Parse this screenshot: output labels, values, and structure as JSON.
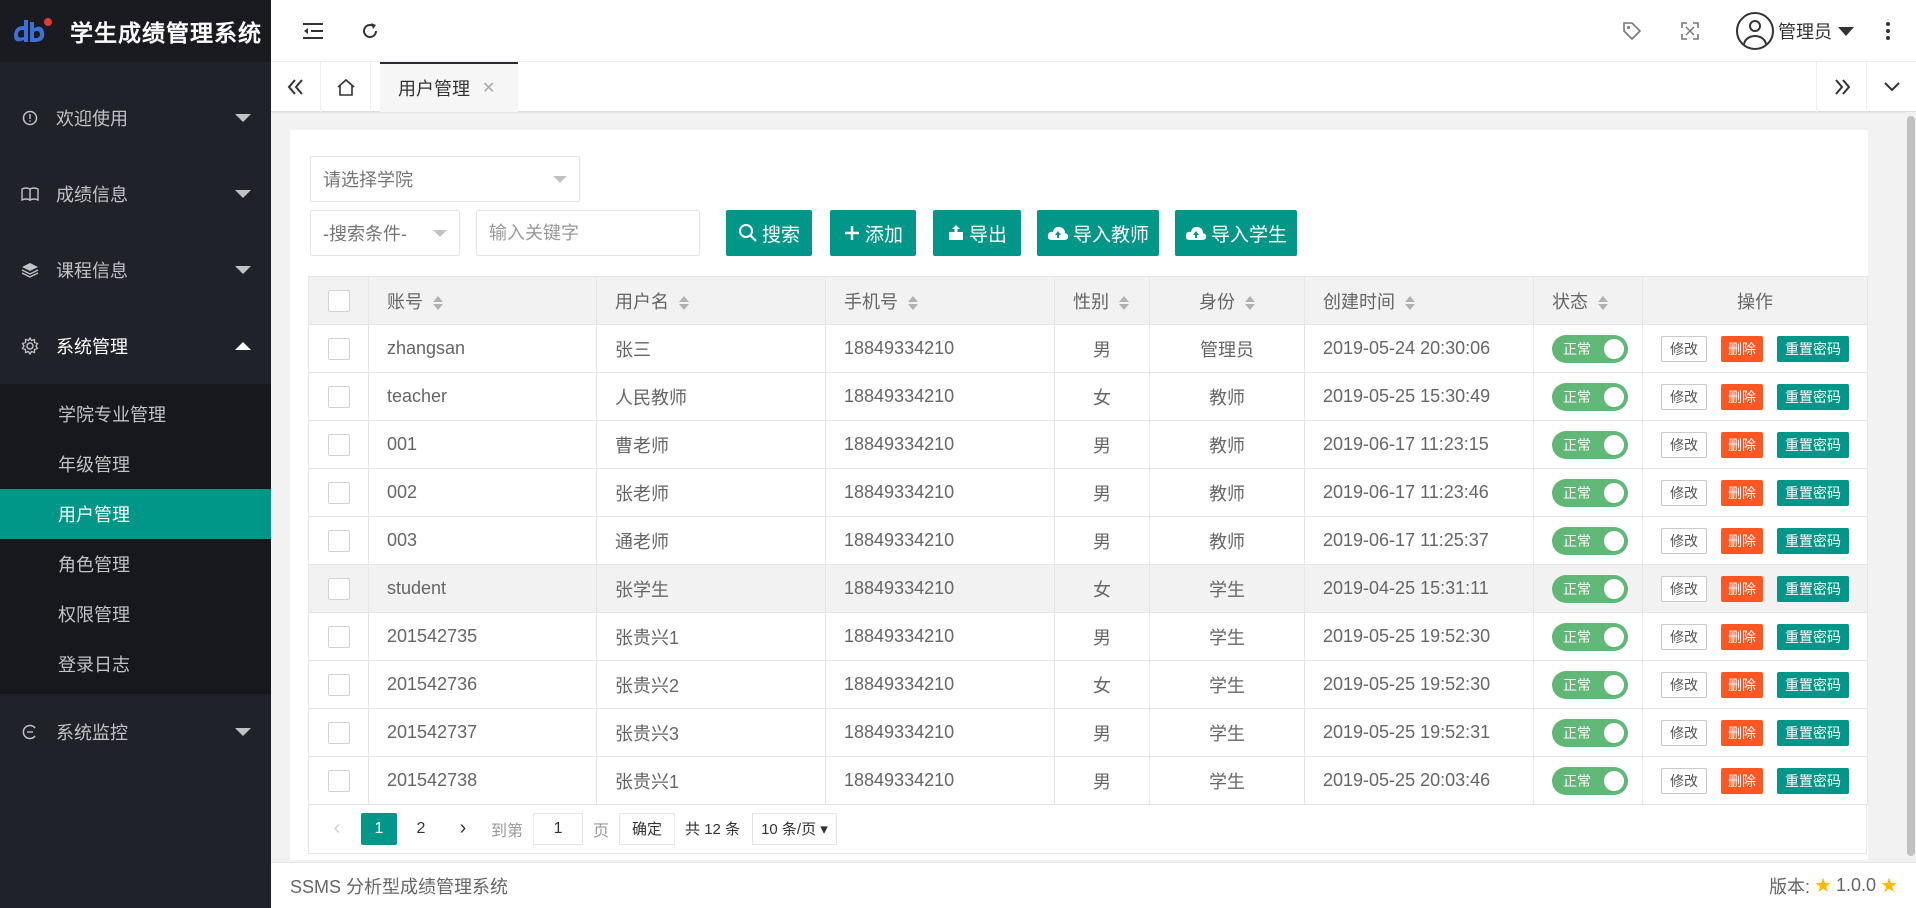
{
  "app": {
    "title": "学生成绩管理系统"
  },
  "sidebar": {
    "items": [
      {
        "label": "欢迎使用",
        "icon": "info-icon"
      },
      {
        "label": "成绩信息",
        "icon": "book-icon"
      },
      {
        "label": "课程信息",
        "icon": "layers-icon"
      },
      {
        "label": "系统管理",
        "icon": "gear-icon"
      },
      {
        "label": "系统监控",
        "icon": "monitor-icon"
      }
    ],
    "subitems": [
      "学院专业管理",
      "年级管理",
      "用户管理",
      "角色管理",
      "权限管理",
      "登录日志"
    ]
  },
  "header": {
    "user": "管理员"
  },
  "tabs": {
    "active": "用户管理"
  },
  "toolbar": {
    "college_placeholder": "请选择学院",
    "condition_placeholder": "-搜索条件-",
    "keyword_placeholder": "输入关键字",
    "search": "搜索",
    "add": "添加",
    "export": "导出",
    "import_teacher": "导入教师",
    "import_student": "导入学生"
  },
  "table": {
    "headers": [
      "账号",
      "用户名",
      "手机号",
      "性别",
      "身份",
      "创建时间",
      "状态",
      "操作"
    ],
    "status_label": "正常",
    "edit_label": "修改",
    "delete_label": "删除",
    "reset_label": "重置密码",
    "rows": [
      {
        "account": "zhangsan",
        "name": "张三",
        "phone": "18849334210",
        "gender": "男",
        "role": "管理员",
        "created": "2019-05-24 20:30:06"
      },
      {
        "account": "teacher",
        "name": "人民教师",
        "phone": "18849334210",
        "gender": "女",
        "role": "教师",
        "created": "2019-05-25 15:30:49"
      },
      {
        "account": "001",
        "name": "曹老师",
        "phone": "18849334210",
        "gender": "男",
        "role": "教师",
        "created": "2019-06-17 11:23:15"
      },
      {
        "account": "002",
        "name": "张老师",
        "phone": "18849334210",
        "gender": "男",
        "role": "教师",
        "created": "2019-06-17 11:23:46"
      },
      {
        "account": "003",
        "name": "通老师",
        "phone": "18849334210",
        "gender": "男",
        "role": "教师",
        "created": "2019-06-17 11:25:37"
      },
      {
        "account": "student",
        "name": "张学生",
        "phone": "18849334210",
        "gender": "女",
        "role": "学生",
        "created": "2019-04-25 15:31:11"
      },
      {
        "account": "201542735",
        "name": "张贵兴1",
        "phone": "18849334210",
        "gender": "男",
        "role": "学生",
        "created": "2019-05-25 19:52:30"
      },
      {
        "account": "201542736",
        "name": "张贵兴2",
        "phone": "18849334210",
        "gender": "女",
        "role": "学生",
        "created": "2019-05-25 19:52:30"
      },
      {
        "account": "201542737",
        "name": "张贵兴3",
        "phone": "18849334210",
        "gender": "男",
        "role": "学生",
        "created": "2019-05-25 19:52:31"
      },
      {
        "account": "201542738",
        "name": "张贵兴1",
        "phone": "18849334210",
        "gender": "男",
        "role": "学生",
        "created": "2019-05-25 20:03:46"
      }
    ]
  },
  "pager": {
    "pages": [
      "1",
      "2"
    ],
    "goto_label": "到第",
    "goto_value": "1",
    "page_unit": "页",
    "confirm": "确定",
    "total": "共 12 条",
    "size": "10 条/页"
  },
  "footer": {
    "left": "SSMS 分析型成绩管理系统",
    "version_label": "版本:",
    "version": "1.0.0"
  },
  "colors": {
    "primary": "#009688",
    "danger": "#ff5722",
    "switch": "#5fb878",
    "sidebar": "#20222a"
  }
}
